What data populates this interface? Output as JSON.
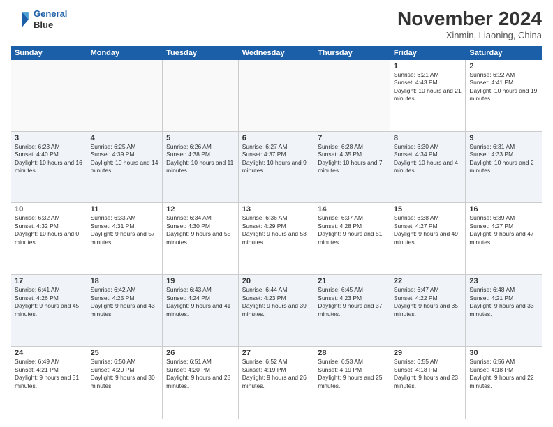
{
  "logo": {
    "line1": "General",
    "line2": "Blue"
  },
  "title": "November 2024",
  "location": "Xinmin, Liaoning, China",
  "header_days": [
    "Sunday",
    "Monday",
    "Tuesday",
    "Wednesday",
    "Thursday",
    "Friday",
    "Saturday"
  ],
  "weeks": [
    [
      {
        "day": "",
        "info": ""
      },
      {
        "day": "",
        "info": ""
      },
      {
        "day": "",
        "info": ""
      },
      {
        "day": "",
        "info": ""
      },
      {
        "day": "",
        "info": ""
      },
      {
        "day": "1",
        "info": "Sunrise: 6:21 AM\nSunset: 4:43 PM\nDaylight: 10 hours and 21 minutes."
      },
      {
        "day": "2",
        "info": "Sunrise: 6:22 AM\nSunset: 4:41 PM\nDaylight: 10 hours and 19 minutes."
      }
    ],
    [
      {
        "day": "3",
        "info": "Sunrise: 6:23 AM\nSunset: 4:40 PM\nDaylight: 10 hours and 16 minutes."
      },
      {
        "day": "4",
        "info": "Sunrise: 6:25 AM\nSunset: 4:39 PM\nDaylight: 10 hours and 14 minutes."
      },
      {
        "day": "5",
        "info": "Sunrise: 6:26 AM\nSunset: 4:38 PM\nDaylight: 10 hours and 11 minutes."
      },
      {
        "day": "6",
        "info": "Sunrise: 6:27 AM\nSunset: 4:37 PM\nDaylight: 10 hours and 9 minutes."
      },
      {
        "day": "7",
        "info": "Sunrise: 6:28 AM\nSunset: 4:35 PM\nDaylight: 10 hours and 7 minutes."
      },
      {
        "day": "8",
        "info": "Sunrise: 6:30 AM\nSunset: 4:34 PM\nDaylight: 10 hours and 4 minutes."
      },
      {
        "day": "9",
        "info": "Sunrise: 6:31 AM\nSunset: 4:33 PM\nDaylight: 10 hours and 2 minutes."
      }
    ],
    [
      {
        "day": "10",
        "info": "Sunrise: 6:32 AM\nSunset: 4:32 PM\nDaylight: 10 hours and 0 minutes."
      },
      {
        "day": "11",
        "info": "Sunrise: 6:33 AM\nSunset: 4:31 PM\nDaylight: 9 hours and 57 minutes."
      },
      {
        "day": "12",
        "info": "Sunrise: 6:34 AM\nSunset: 4:30 PM\nDaylight: 9 hours and 55 minutes."
      },
      {
        "day": "13",
        "info": "Sunrise: 6:36 AM\nSunset: 4:29 PM\nDaylight: 9 hours and 53 minutes."
      },
      {
        "day": "14",
        "info": "Sunrise: 6:37 AM\nSunset: 4:28 PM\nDaylight: 9 hours and 51 minutes."
      },
      {
        "day": "15",
        "info": "Sunrise: 6:38 AM\nSunset: 4:27 PM\nDaylight: 9 hours and 49 minutes."
      },
      {
        "day": "16",
        "info": "Sunrise: 6:39 AM\nSunset: 4:27 PM\nDaylight: 9 hours and 47 minutes."
      }
    ],
    [
      {
        "day": "17",
        "info": "Sunrise: 6:41 AM\nSunset: 4:26 PM\nDaylight: 9 hours and 45 minutes."
      },
      {
        "day": "18",
        "info": "Sunrise: 6:42 AM\nSunset: 4:25 PM\nDaylight: 9 hours and 43 minutes."
      },
      {
        "day": "19",
        "info": "Sunrise: 6:43 AM\nSunset: 4:24 PM\nDaylight: 9 hours and 41 minutes."
      },
      {
        "day": "20",
        "info": "Sunrise: 6:44 AM\nSunset: 4:23 PM\nDaylight: 9 hours and 39 minutes."
      },
      {
        "day": "21",
        "info": "Sunrise: 6:45 AM\nSunset: 4:23 PM\nDaylight: 9 hours and 37 minutes."
      },
      {
        "day": "22",
        "info": "Sunrise: 6:47 AM\nSunset: 4:22 PM\nDaylight: 9 hours and 35 minutes."
      },
      {
        "day": "23",
        "info": "Sunrise: 6:48 AM\nSunset: 4:21 PM\nDaylight: 9 hours and 33 minutes."
      }
    ],
    [
      {
        "day": "24",
        "info": "Sunrise: 6:49 AM\nSunset: 4:21 PM\nDaylight: 9 hours and 31 minutes."
      },
      {
        "day": "25",
        "info": "Sunrise: 6:50 AM\nSunset: 4:20 PM\nDaylight: 9 hours and 30 minutes."
      },
      {
        "day": "26",
        "info": "Sunrise: 6:51 AM\nSunset: 4:20 PM\nDaylight: 9 hours and 28 minutes."
      },
      {
        "day": "27",
        "info": "Sunrise: 6:52 AM\nSunset: 4:19 PM\nDaylight: 9 hours and 26 minutes."
      },
      {
        "day": "28",
        "info": "Sunrise: 6:53 AM\nSunset: 4:19 PM\nDaylight: 9 hours and 25 minutes."
      },
      {
        "day": "29",
        "info": "Sunrise: 6:55 AM\nSunset: 4:18 PM\nDaylight: 9 hours and 23 minutes."
      },
      {
        "day": "30",
        "info": "Sunrise: 6:56 AM\nSunset: 4:18 PM\nDaylight: 9 hours and 22 minutes."
      }
    ]
  ]
}
